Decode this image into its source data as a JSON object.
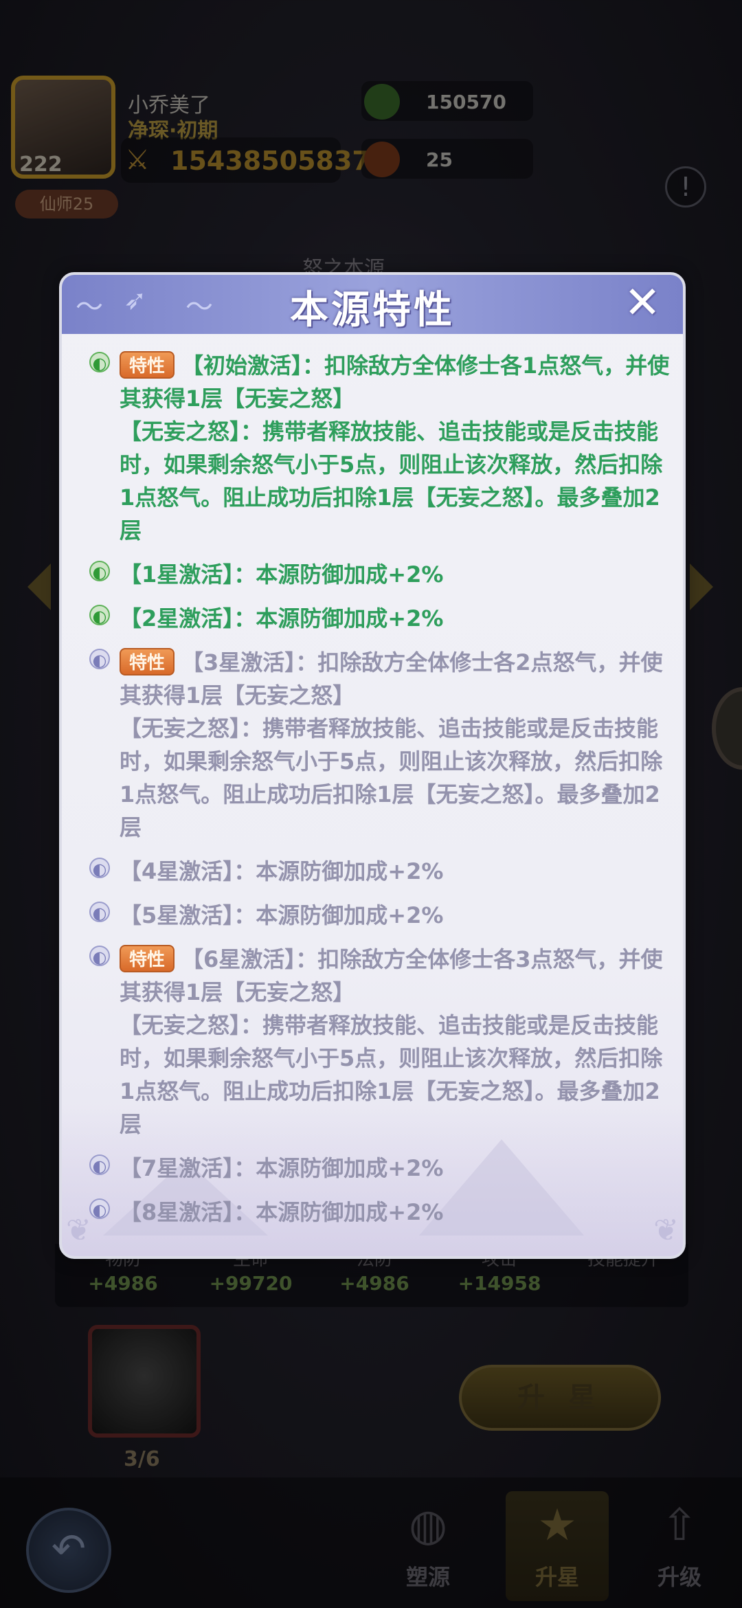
{
  "player": {
    "name": "小乔美了",
    "title": "净琛·初期",
    "level": "222",
    "power": "15438505837",
    "rank": "仙师25"
  },
  "resources": [
    {
      "icon": "gem-plus-icon",
      "value": "150570",
      "color": "#3a6a2a"
    },
    {
      "icon": "beetle-plus-icon",
      "value": "25",
      "color": "#7a3a1a"
    }
  ],
  "background": {
    "section_title": "怒之本源",
    "stats": [
      {
        "label": "物防",
        "value": "+4986"
      },
      {
        "label": "生命",
        "value": "+99720"
      },
      {
        "label": "法防",
        "value": "+4986"
      },
      {
        "label": "攻击",
        "value": "+14958"
      },
      {
        "label": "技能提升",
        "value": ""
      }
    ],
    "item_count": "3/6",
    "upstar_label": "升 星",
    "tabs": [
      {
        "label": "塑源",
        "icon": "planet-icon"
      },
      {
        "label": "升星",
        "icon": "star-icon"
      },
      {
        "label": "升级",
        "icon": "arrow-up-icon"
      }
    ]
  },
  "modal": {
    "title": "本源特性",
    "badge_label": "特性",
    "entries": [
      {
        "status": "active",
        "has_badge": true,
        "text": "【初始激活】：扣除敌方全体修士各1点怒气，并使其获得1层【无妄之怒】",
        "detail": "【无妄之怒】：携带者释放技能、追击技能或是反击技能时，如果剩余怒气小于5点，则阻止该次释放，然后扣除1点怒气。阻止成功后扣除1层【无妄之怒】。最多叠加2层"
      },
      {
        "status": "active",
        "has_badge": false,
        "text": "【1星激活】：本源防御加成+2%"
      },
      {
        "status": "active",
        "has_badge": false,
        "text": "【2星激活】：本源防御加成+2%"
      },
      {
        "status": "locked",
        "has_badge": true,
        "text": "【3星激活】：扣除敌方全体修士各2点怒气，并使其获得1层【无妄之怒】",
        "detail": "【无妄之怒】：携带者释放技能、追击技能或是反击技能时，如果剩余怒气小于5点，则阻止该次释放，然后扣除1点怒气。阻止成功后扣除1层【无妄之怒】。最多叠加2层"
      },
      {
        "status": "locked",
        "has_badge": false,
        "text": "【4星激活】：本源防御加成+2%"
      },
      {
        "status": "locked",
        "has_badge": false,
        "text": "【5星激活】：本源防御加成+2%"
      },
      {
        "status": "locked",
        "has_badge": true,
        "text": "【6星激活】：扣除敌方全体修士各3点怒气，并使其获得1层【无妄之怒】",
        "detail": "【无妄之怒】：携带者释放技能、追击技能或是反击技能时，如果剩余怒气小于5点，则阻止该次释放，然后扣除1点怒气。阻止成功后扣除1层【无妄之怒】。最多叠加2层"
      },
      {
        "status": "locked",
        "has_badge": false,
        "text": "【7星激活】：本源防御加成+2%"
      },
      {
        "status": "locked",
        "has_badge": false,
        "text": "【8星激活】：本源防御加成+2%"
      }
    ]
  },
  "colors": {
    "active_text": "#2e9e5c",
    "locked_text": "#9493ad",
    "header": "#8a92d4",
    "badge": "#e07a36"
  }
}
